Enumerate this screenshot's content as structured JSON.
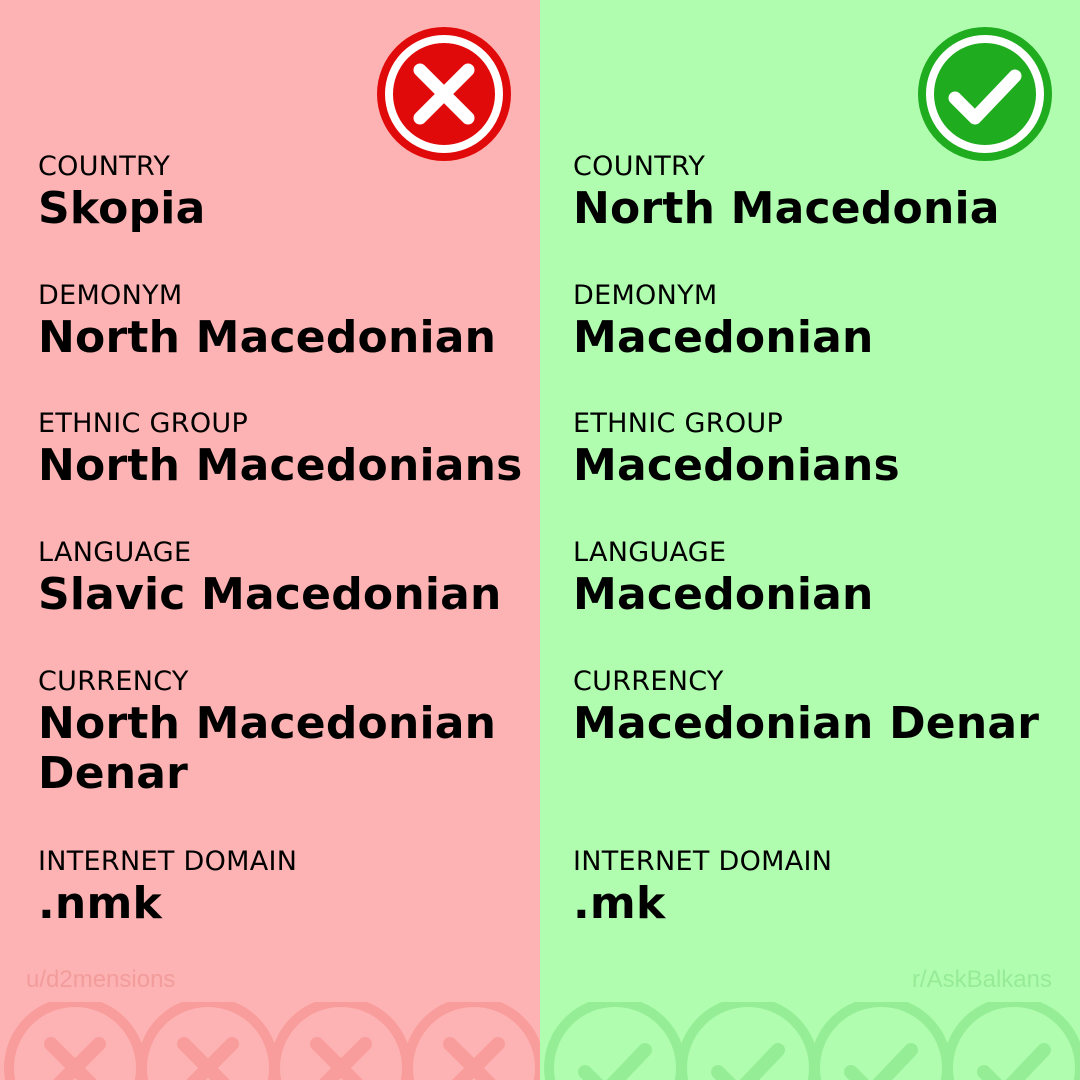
{
  "wrong": {
    "icon": "cross-icon",
    "color": "#e10a0a",
    "credit": "u/d2mensions",
    "fields": [
      {
        "label": "COUNTRY",
        "value": "Skopia"
      },
      {
        "label": "DEMONYM",
        "value": "North Macedonian"
      },
      {
        "label": "ETHNIC GROUP",
        "value": "North Macedonians"
      },
      {
        "label": "LANGUAGE",
        "value": "Slavic Macedonian"
      },
      {
        "label": "CURRENCY",
        "value": "North Macedonian Denar"
      },
      {
        "label": "INTERNET DOMAIN",
        "value": ".nmk"
      }
    ]
  },
  "right": {
    "icon": "check-icon",
    "color": "#1fac1f",
    "credit": "r/AskBalkans",
    "fields": [
      {
        "label": "COUNTRY",
        "value": "North Macedonia"
      },
      {
        "label": "DEMONYM",
        "value": "Macedonian"
      },
      {
        "label": "ETHNIC GROUP",
        "value": "Macedonians"
      },
      {
        "label": "LANGUAGE",
        "value": "Macedonian"
      },
      {
        "label": "CURRENCY",
        "value": "Macedonian Denar"
      },
      {
        "label": "INTERNET DOMAIN",
        "value": ".mk"
      }
    ]
  }
}
